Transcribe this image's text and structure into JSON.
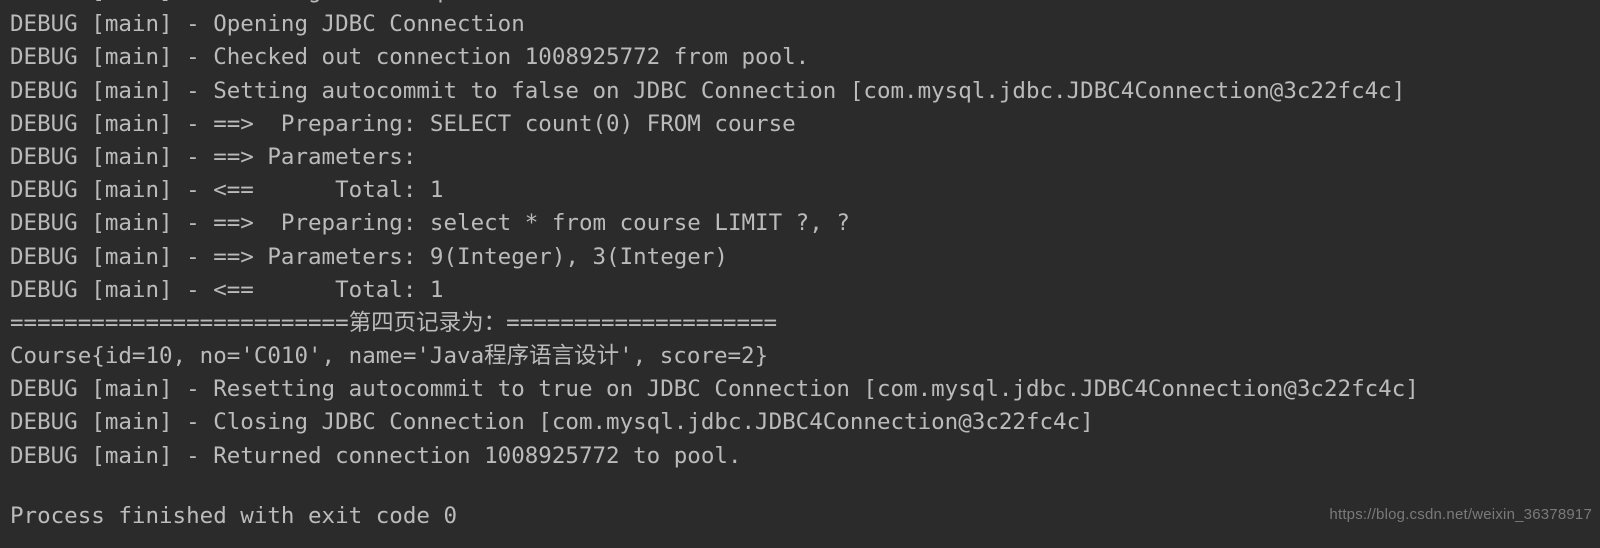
{
  "console": {
    "app": "IntelliJ IDEA Run Console",
    "background_color": "#2b2b2b",
    "text_color": "#bbbbbb",
    "watermark_color": "#7a7a7a",
    "clipped_top_line": "DEBUG [main] - Creating a new SqlSession",
    "lines": [
      "DEBUG [main] - Opening JDBC Connection",
      "DEBUG [main] - Checked out connection 1008925772 from pool.",
      "DEBUG [main] - Setting autocommit to false on JDBC Connection [com.mysql.jdbc.JDBC4Connection@3c22fc4c]",
      "DEBUG [main] - ==>  Preparing: SELECT count(0) FROM course",
      "DEBUG [main] - ==> Parameters:",
      "DEBUG [main] - <==      Total: 1",
      "DEBUG [main] - ==>  Preparing: select * from course LIMIT ?, ?",
      "DEBUG [main] - ==> Parameters: 9(Integer), 3(Integer)",
      "DEBUG [main] - <==      Total: 1",
      "=========================第四页记录为：====================",
      "Course{id=10, no='C010', name='Java程序语言设计', score=2}",
      "DEBUG [main] - Resetting autocommit to true on JDBC Connection [com.mysql.jdbc.JDBC4Connection@3c22fc4c]",
      "DEBUG [main] - Closing JDBC Connection [com.mysql.jdbc.JDBC4Connection@3c22fc4c]",
      "DEBUG [main] - Returned connection 1008925772 to pool.",
      ""
    ],
    "process_status": "Process finished with exit code 0",
    "watermark": "https://blog.csdn.net/weixin_36378917"
  }
}
